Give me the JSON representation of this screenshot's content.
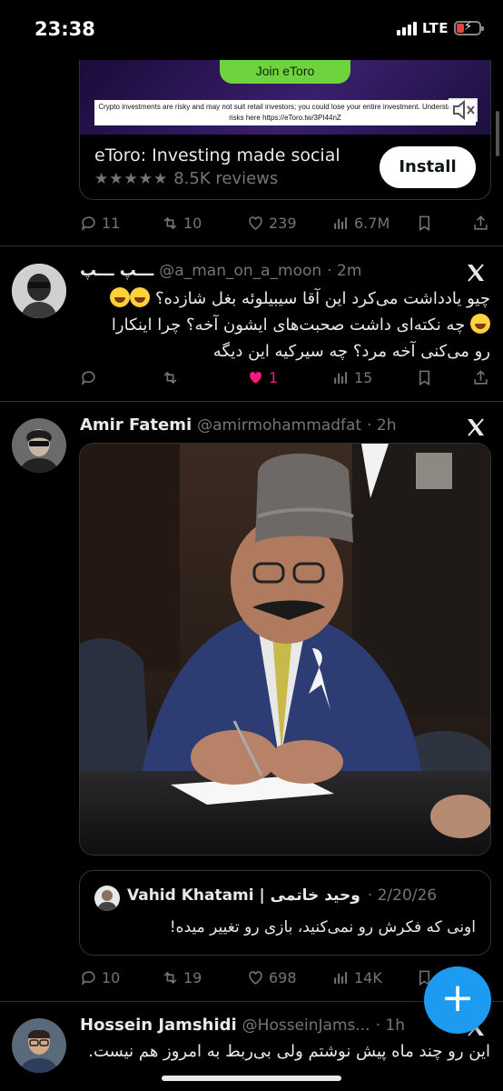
{
  "status_bar": {
    "time": "23:38",
    "network": "LTE",
    "icons": [
      "signal-icon",
      "battery-charging-icon"
    ]
  },
  "ad": {
    "cta_label": "Join eToro",
    "disclaimer": "Crypto investments are risky and may not suit retail investors; you could lose your entire investment. Understand the risks here https://eToro.tw/3PI44nZ",
    "title": "eToro: Investing made social",
    "rating_stars": "★★★★★",
    "rating": 4.5,
    "reviews": "8.5K reviews",
    "install_label": "Install",
    "stats": {
      "replies": "11",
      "reposts": "10",
      "likes": "239",
      "views": "6.7M"
    }
  },
  "tweets": [
    {
      "name": "ـــپ ـــپ",
      "handle": "@a_man_on_a_moon",
      "time": "· 2m",
      "lines": [
        "چیو یادداشت می‌کرد این آقا سیبیلوئه بغل شازده؟",
        "چه نکته‌ای داشت صحبت‌های ایشون آخه؟ چرا اینکارا",
        "رو می‌کنی آخه مرد؟ چه سیرکیه این دیگه"
      ],
      "stats": {
        "replies": "",
        "reposts": "",
        "likes": "1",
        "views": "15"
      }
    },
    {
      "name": "Amir Fatemi",
      "handle": "@amirmohammadfat",
      "time": "· 2h",
      "quote": {
        "name": "Vahid Khatami | وحید خاتمی",
        "date": "· 2/20/26",
        "text": "اونی که فکرش رو نمی‌کنید، بازی رو تغییر میده!"
      },
      "stats": {
        "replies": "10",
        "reposts": "19",
        "likes": "698",
        "views": "14K"
      }
    },
    {
      "name": "Hossein Jamshidi",
      "handle": "@HosseinJams...",
      "time": "· 1h",
      "text": "این رو چند ماه پیش نوشتم ولی بی‌ربط به امروز هم نیست."
    }
  ],
  "fab_label": "+",
  "colors": {
    "accent": "#1d9bf0",
    "like": "#f91880",
    "muted": "#71767b",
    "etoro_green": "#6fd33f"
  }
}
